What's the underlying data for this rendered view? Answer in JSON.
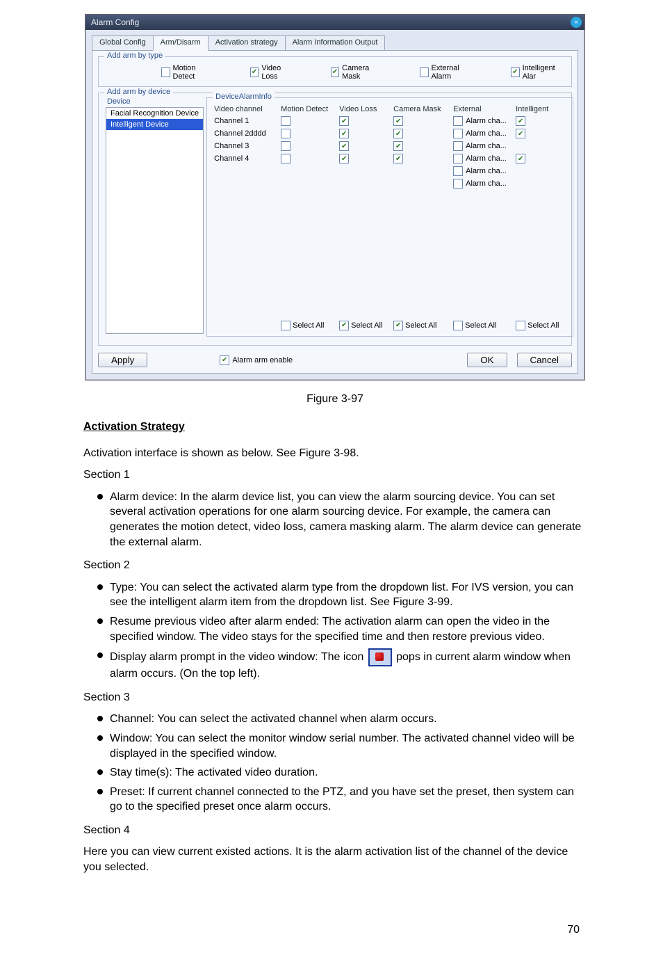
{
  "dialog": {
    "title": "Alarm Config",
    "tabs": [
      "Global Config",
      "Arm/Disarm",
      "Activation strategy",
      "Alarm Information Output"
    ],
    "active_tab_index": 1,
    "arm_type": {
      "label": "Add arm by type",
      "items": [
        {
          "label": "Motion Detect",
          "checked": false
        },
        {
          "label": "Video Loss",
          "checked": true
        },
        {
          "label": "Camera Mask",
          "checked": true
        },
        {
          "label": "External Alarm",
          "checked": false
        },
        {
          "label": "Intelligent Alar",
          "checked": true
        }
      ]
    },
    "arm_device": {
      "label": "Add arm by device",
      "device_label": "Device",
      "info_label": "DeviceAlarmInfo",
      "devices": [
        {
          "name": "Facial Recognition Device",
          "selected": false
        },
        {
          "name": "Intelligent Device",
          "selected": true
        }
      ],
      "columns": [
        "Video channel",
        "Motion Detect",
        "Video Loss",
        "Camera Mask",
        "External",
        "Intelligent"
      ],
      "rows": [
        {
          "ch": "Channel 1",
          "md": false,
          "vl": true,
          "cm": true,
          "ext_label": "Alarm cha...",
          "ext": false,
          "intl": true
        },
        {
          "ch": "Channel 2dddd",
          "md": false,
          "vl": true,
          "cm": true,
          "ext_label": "Alarm cha...",
          "ext": false,
          "intl": true
        },
        {
          "ch": "Channel 3",
          "md": false,
          "vl": true,
          "cm": true,
          "ext_label": "Alarm cha...",
          "ext": false,
          "intl": null
        },
        {
          "ch": "Channel 4",
          "md": false,
          "vl": true,
          "cm": true,
          "ext_label": "Alarm cha...",
          "ext": false,
          "intl": true
        }
      ],
      "extra_ext": [
        {
          "label": "Alarm cha...",
          "checked": false
        },
        {
          "label": "Alarm cha...",
          "checked": false
        }
      ],
      "select_all_label": "Select All",
      "select_all": {
        "md": false,
        "vl": true,
        "cm": true,
        "ext": false,
        "intl": false
      }
    },
    "bottom": {
      "apply": "Apply",
      "alarm_enable_label": "Alarm arm enable",
      "alarm_enable_checked": true,
      "ok": "OK",
      "cancel": "Cancel"
    }
  },
  "caption": "Figure 3-97",
  "doc": {
    "heading": "Activation Strategy",
    "intro": "Activation interface is shown as below. See Figure 3-98.",
    "section1_label": "Section 1",
    "bullets1": [
      "Alarm device: In the alarm device list, you can view the alarm sourcing device. You can set several activation operations for one alarm sourcing device. For example, the camera can generates the motion detect, video loss, camera masking alarm. The alarm device can generate the external alarm."
    ],
    "section2_label": "Section 2",
    "bullets2": [
      "Type: You can select the activated alarm type from the dropdown list. For IVS version, you can see the intelligent alarm item from the dropdown list. See Figure 3-99.",
      "Resume previous video after alarm ended: The activation alarm can open the video in the specified window. The video stays for the specified time and then restore previous video."
    ],
    "bullet2_icon_pre": "Display alarm prompt in the video window: The icon",
    "bullet2_icon_post": "pops in current alarm window when alarm occurs. (On the top left).",
    "section3_label": "Section 3",
    "bullets3": [
      "Channel: You can select the activated channel when alarm occurs.",
      "Window: You can select the monitor window serial number. The activated channel video will be displayed in the specified window.",
      "Stay time(s): The activated video duration.",
      "Preset: If current channel connected to the PTZ, and you have set the preset, then system can go to the specified preset once alarm occurs."
    ],
    "section4_label": "Section 4",
    "section4_text": "Here you can view current existed actions. It is the alarm activation list of the channel of the device you selected."
  },
  "page_number": "70"
}
